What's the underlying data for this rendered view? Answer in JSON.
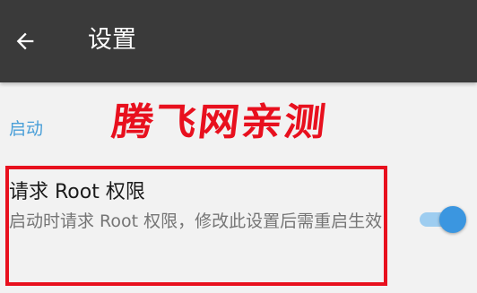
{
  "app_bar": {
    "title": "设置",
    "back_icon": "arrow-back-icon"
  },
  "watermark": {
    "text": "腾飞网亲测",
    "color": "#e8101e"
  },
  "section": {
    "header": "启动"
  },
  "preference": {
    "title": "请求 Root 权限",
    "summary": "启动时请求 Root 权限，修改此设置后需重启生效",
    "switch_on": true
  },
  "colors": {
    "app_bar": "#3a3a3a",
    "background": "#f2f2f2",
    "accent": "#3b96e0",
    "section_header": "#4a9fd8",
    "highlight": "#e8101e"
  }
}
